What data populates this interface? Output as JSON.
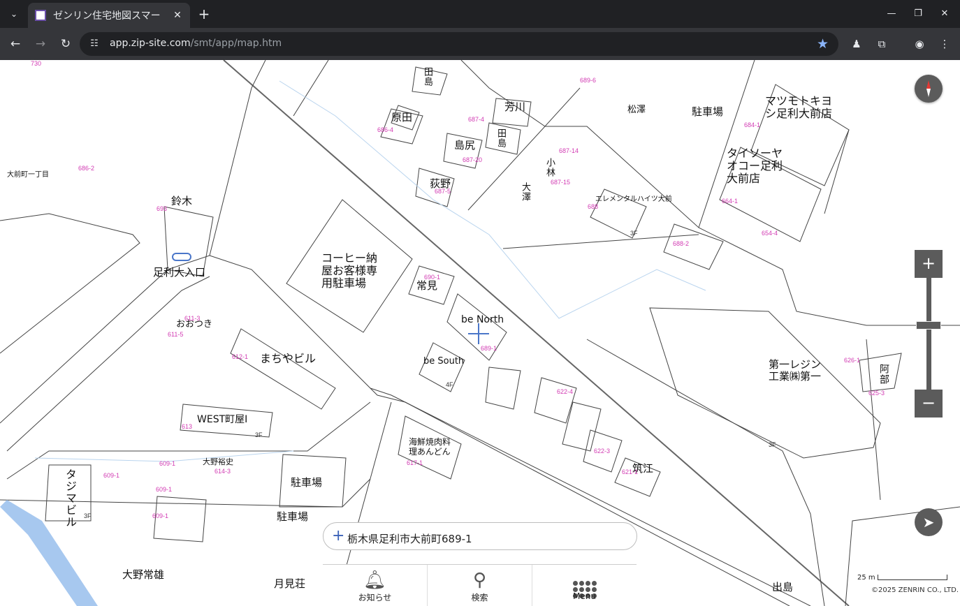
{
  "browser": {
    "tab_title": "ゼンリン住宅地図スマー",
    "tab_close": "✕",
    "new_tab": "+",
    "url_host": "app.zip-site.com",
    "url_path": "/smt/app/map.htm",
    "icons": [
      "tab-list-icon",
      "back-icon",
      "forward-icon",
      "reload-icon",
      "site-info-icon",
      "star-icon",
      "extension-icon",
      "puzzle-icon",
      "profile-icon",
      "kebab-menu-icon",
      "minimize-icon",
      "restore-icon",
      "close-icon"
    ]
  },
  "map": {
    "labels": {
      "matsumoto": "マツモトキヨシ足利大前店",
      "yaoko": "タイソーヤオコー足利大前店",
      "coffee_parking": "コーヒー納屋お客様専用駐車場",
      "ashikaga_entrance": "足利大入口",
      "machiya": "まちやビル",
      "west": "WEST町屋Ⅰ",
      "tajima": "タジマビル",
      "be_north": "be North",
      "be_south": "be South",
      "daiichi": "第一レジン工業㈱第一",
      "parking1": "駐車場",
      "parking2": "駐車場",
      "parking3": "駐車場",
      "element": "エレメンタルハイツ大前",
      "suzuki": "鈴木",
      "ooshima": "おおつき",
      "harada": "原田",
      "tanaka": "田島",
      "yoshikawa": "芳川",
      "shimaji": "島尻",
      "tadashima": "田島",
      "ogino": "荻野",
      "omura": "大澤",
      "kobayashi": "小林",
      "matsuzawa": "松澤",
      "tsuneshi": "常見",
      "ono": "大野裕史",
      "restaurant": "海鮮焼肉料理あんどん",
      "tsukuma": "筑江",
      "abe": "阿部",
      "ooshima_house": "大野常雄",
      "gekkenso": "月見荘",
      "izuno": "出島",
      "daimae1": "大前町一丁目"
    },
    "numbers": [
      "690-1",
      "689-1",
      "612-1",
      "613",
      "614-3",
      "609-1",
      "609-1",
      "609-1",
      "609-1",
      "626-1",
      "625-3",
      "664-1",
      "654-4",
      "688-2",
      "684-1",
      "693",
      "686-2",
      "611-5",
      "611-3",
      "617-1",
      "622-4",
      "622-3",
      "621-1",
      "686-4",
      "687-20",
      "687-5",
      "687-4",
      "687-15",
      "687-14",
      "689-6",
      "688",
      "730"
    ],
    "floor_marks": [
      "3F",
      "3F",
      "3F",
      "4F",
      "3F"
    ]
  },
  "controls": {
    "zoom_in": "+",
    "zoom_out": "−",
    "zoom_level": 0.7,
    "locate": "➤"
  },
  "address_bar": {
    "plus": "+",
    "address": "栃木県足利市大前町689-1"
  },
  "bottom_menu": {
    "notice": "お知らせ",
    "search": "検索",
    "menu": "Menu"
  },
  "scale_label": "25 m",
  "copyright": "©2025 ZENRIN CO., LTD."
}
